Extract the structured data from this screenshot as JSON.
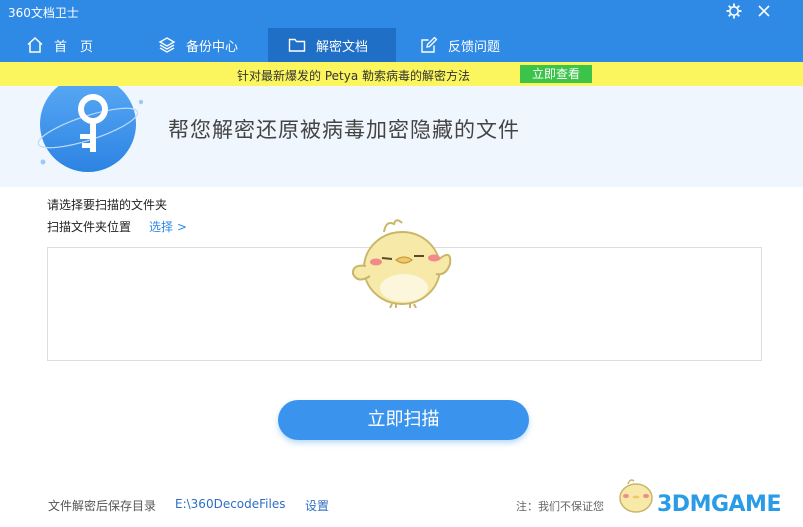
{
  "app": {
    "title": "360文档卫士"
  },
  "tabs": [
    {
      "label": "首　页",
      "icon": "home-icon",
      "active": false
    },
    {
      "label": "备份中心",
      "icon": "layers-icon",
      "active": false
    },
    {
      "label": "解密文档",
      "icon": "folder-icon",
      "active": true
    },
    {
      "label": "反馈问题",
      "icon": "edit-icon",
      "active": false
    }
  ],
  "banner": {
    "text": "针对最新爆发的 Petya 勒索病毒的解密方法",
    "button_label": "立即查看"
  },
  "hero": {
    "title": "帮您解密还原被病毒加密隐藏的文件",
    "icon": "key-icon"
  },
  "scan": {
    "instruction": "请选择要扫描的文件夹",
    "location_label": "扫描文件夹位置",
    "select_link": "选择 >",
    "button_label": "立即扫描"
  },
  "footer": {
    "save_dir_label": "文件解密后保存目录",
    "save_dir_path": "E:\\360DecodeFiles",
    "settings_label": "设置",
    "note": "注：我们不保证您"
  },
  "watermark": {
    "text": "3DMGAME"
  },
  "colors": {
    "header": "#2f8ae6",
    "active_tab": "#1f6fc6",
    "banner": "#fbf65d",
    "banner_button": "#3cc34a",
    "primary_button": "#3a94ee"
  }
}
